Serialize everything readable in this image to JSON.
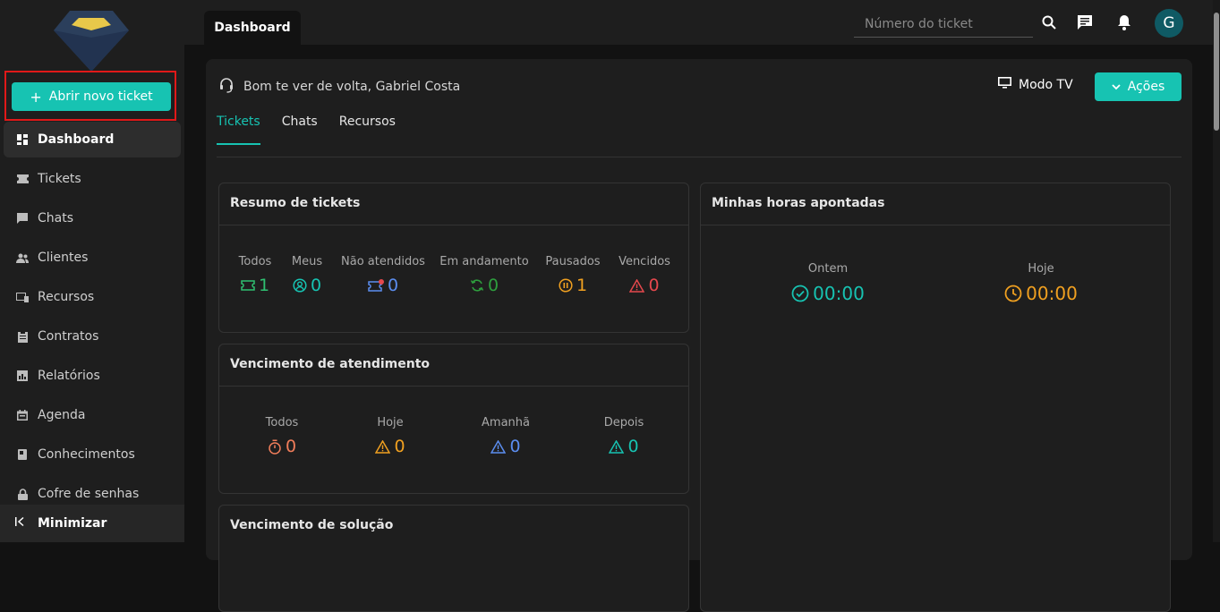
{
  "sidebar": {
    "new_ticket_label": "Abrir novo ticket",
    "items": [
      {
        "label": "Dashboard",
        "icon": "dashboard-icon"
      },
      {
        "label": "Tickets",
        "icon": "ticket-icon"
      },
      {
        "label": "Chats",
        "icon": "chat-icon"
      },
      {
        "label": "Clientes",
        "icon": "people-icon"
      },
      {
        "label": "Recursos",
        "icon": "devices-icon"
      },
      {
        "label": "Contratos",
        "icon": "clipboard-icon"
      },
      {
        "label": "Relatórios",
        "icon": "report-icon"
      },
      {
        "label": "Agenda",
        "icon": "calendar-icon"
      },
      {
        "label": "Conhecimentos",
        "icon": "book-icon"
      },
      {
        "label": "Cofre de senhas",
        "icon": "lock-icon"
      }
    ],
    "minimize_label": "Minimizar"
  },
  "topbar": {
    "active_tab": "Dashboard",
    "search_placeholder": "Número do ticket",
    "avatar_initial": "G"
  },
  "main": {
    "welcome": "Bom te ver de volta, Gabriel Costa",
    "tv_mode_label": "Modo TV",
    "actions_label": "Ações",
    "tabs": [
      "Tickets",
      "Chats",
      "Recursos"
    ]
  },
  "ticket_summary": {
    "title": "Resumo de tickets",
    "stats": [
      {
        "label": "Todos",
        "value": "1",
        "color": "#2fbf71",
        "icon": "ticket-icon"
      },
      {
        "label": "Meus",
        "value": "0",
        "color": "#17c3b2",
        "icon": "user-circle-icon"
      },
      {
        "label": "Não atendidos",
        "value": "0",
        "color": "#5b8def",
        "icon": "ticket-alert-icon"
      },
      {
        "label": "Em andamento",
        "value": "0",
        "color": "#2e9e3e",
        "icon": "sync-icon"
      },
      {
        "label": "Pausados",
        "value": "1",
        "color": "#f0a020",
        "icon": "pause-circle-icon"
      },
      {
        "label": "Vencidos",
        "value": "0",
        "color": "#e5484d",
        "icon": "warning-icon"
      }
    ]
  },
  "service_due": {
    "title": "Vencimento de atendimento",
    "stats": [
      {
        "label": "Todos",
        "value": "0",
        "color": "#f07d5a",
        "icon": "timer-icon"
      },
      {
        "label": "Hoje",
        "value": "0",
        "color": "#f0a020",
        "icon": "warning-icon"
      },
      {
        "label": "Amanhã",
        "value": "0",
        "color": "#5b8def",
        "icon": "warning-icon"
      },
      {
        "label": "Depois",
        "value": "0",
        "color": "#17c3b2",
        "icon": "warning-icon"
      }
    ]
  },
  "solution_due": {
    "title": "Vencimento de solução"
  },
  "hours": {
    "title": "Minhas horas apontadas",
    "stats": [
      {
        "label": "Ontem",
        "value": "00:00",
        "color": "#17c3b2",
        "icon": "check-circle-icon"
      },
      {
        "label": "Hoje",
        "value": "00:00",
        "color": "#f0a020",
        "icon": "clock-icon"
      }
    ]
  }
}
